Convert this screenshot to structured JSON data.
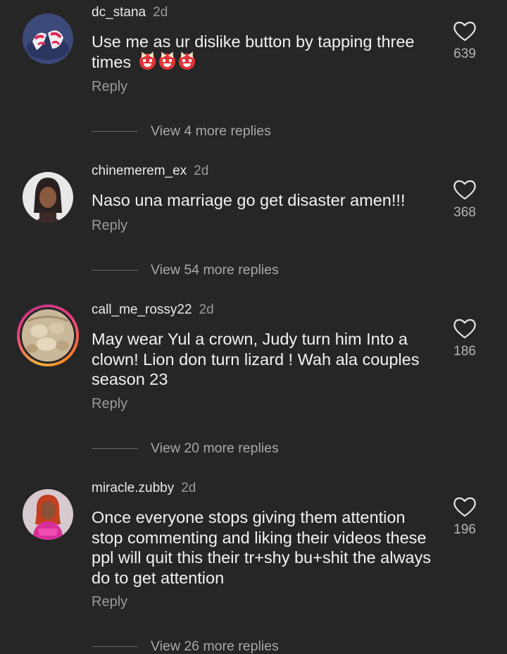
{
  "comments": [
    {
      "username": "dc_stana",
      "age": "2d",
      "text": "Use me as ur dislike button by tapping three times",
      "emoji_count": 3,
      "likes": "639",
      "reply_label": "Reply",
      "view_more": "View 4 more replies"
    },
    {
      "username": "chinemerem_ex",
      "age": "2d",
      "text": "Naso una marriage go get disaster amen!!!",
      "likes": "368",
      "reply_label": "Reply",
      "view_more": "View 54 more replies"
    },
    {
      "username": "call_me_rossy22",
      "age": "2d",
      "text": "May wear Yul a crown, Judy turn him Into a clown! Lion don turn lizard ! Wah ala couples season 23",
      "likes": "186",
      "reply_label": "Reply",
      "view_more": "View 20 more replies"
    },
    {
      "username": "miracle.zubby",
      "age": "2d",
      "text": "Once everyone stops giving them attention stop commenting and liking their videos these ppl will quit this their tr+shy bu+shit the always do to get attention",
      "likes": "196",
      "reply_label": "Reply",
      "view_more": "View 26 more replies"
    }
  ],
  "icons": {
    "like": "heart-outline-icon",
    "emoji": "japanese-ogre-emoji"
  },
  "colors": {
    "background": "#262626",
    "text_primary": "#f2f2f2",
    "text_secondary": "#9a9a9a",
    "story_ring": "#e8407a"
  }
}
